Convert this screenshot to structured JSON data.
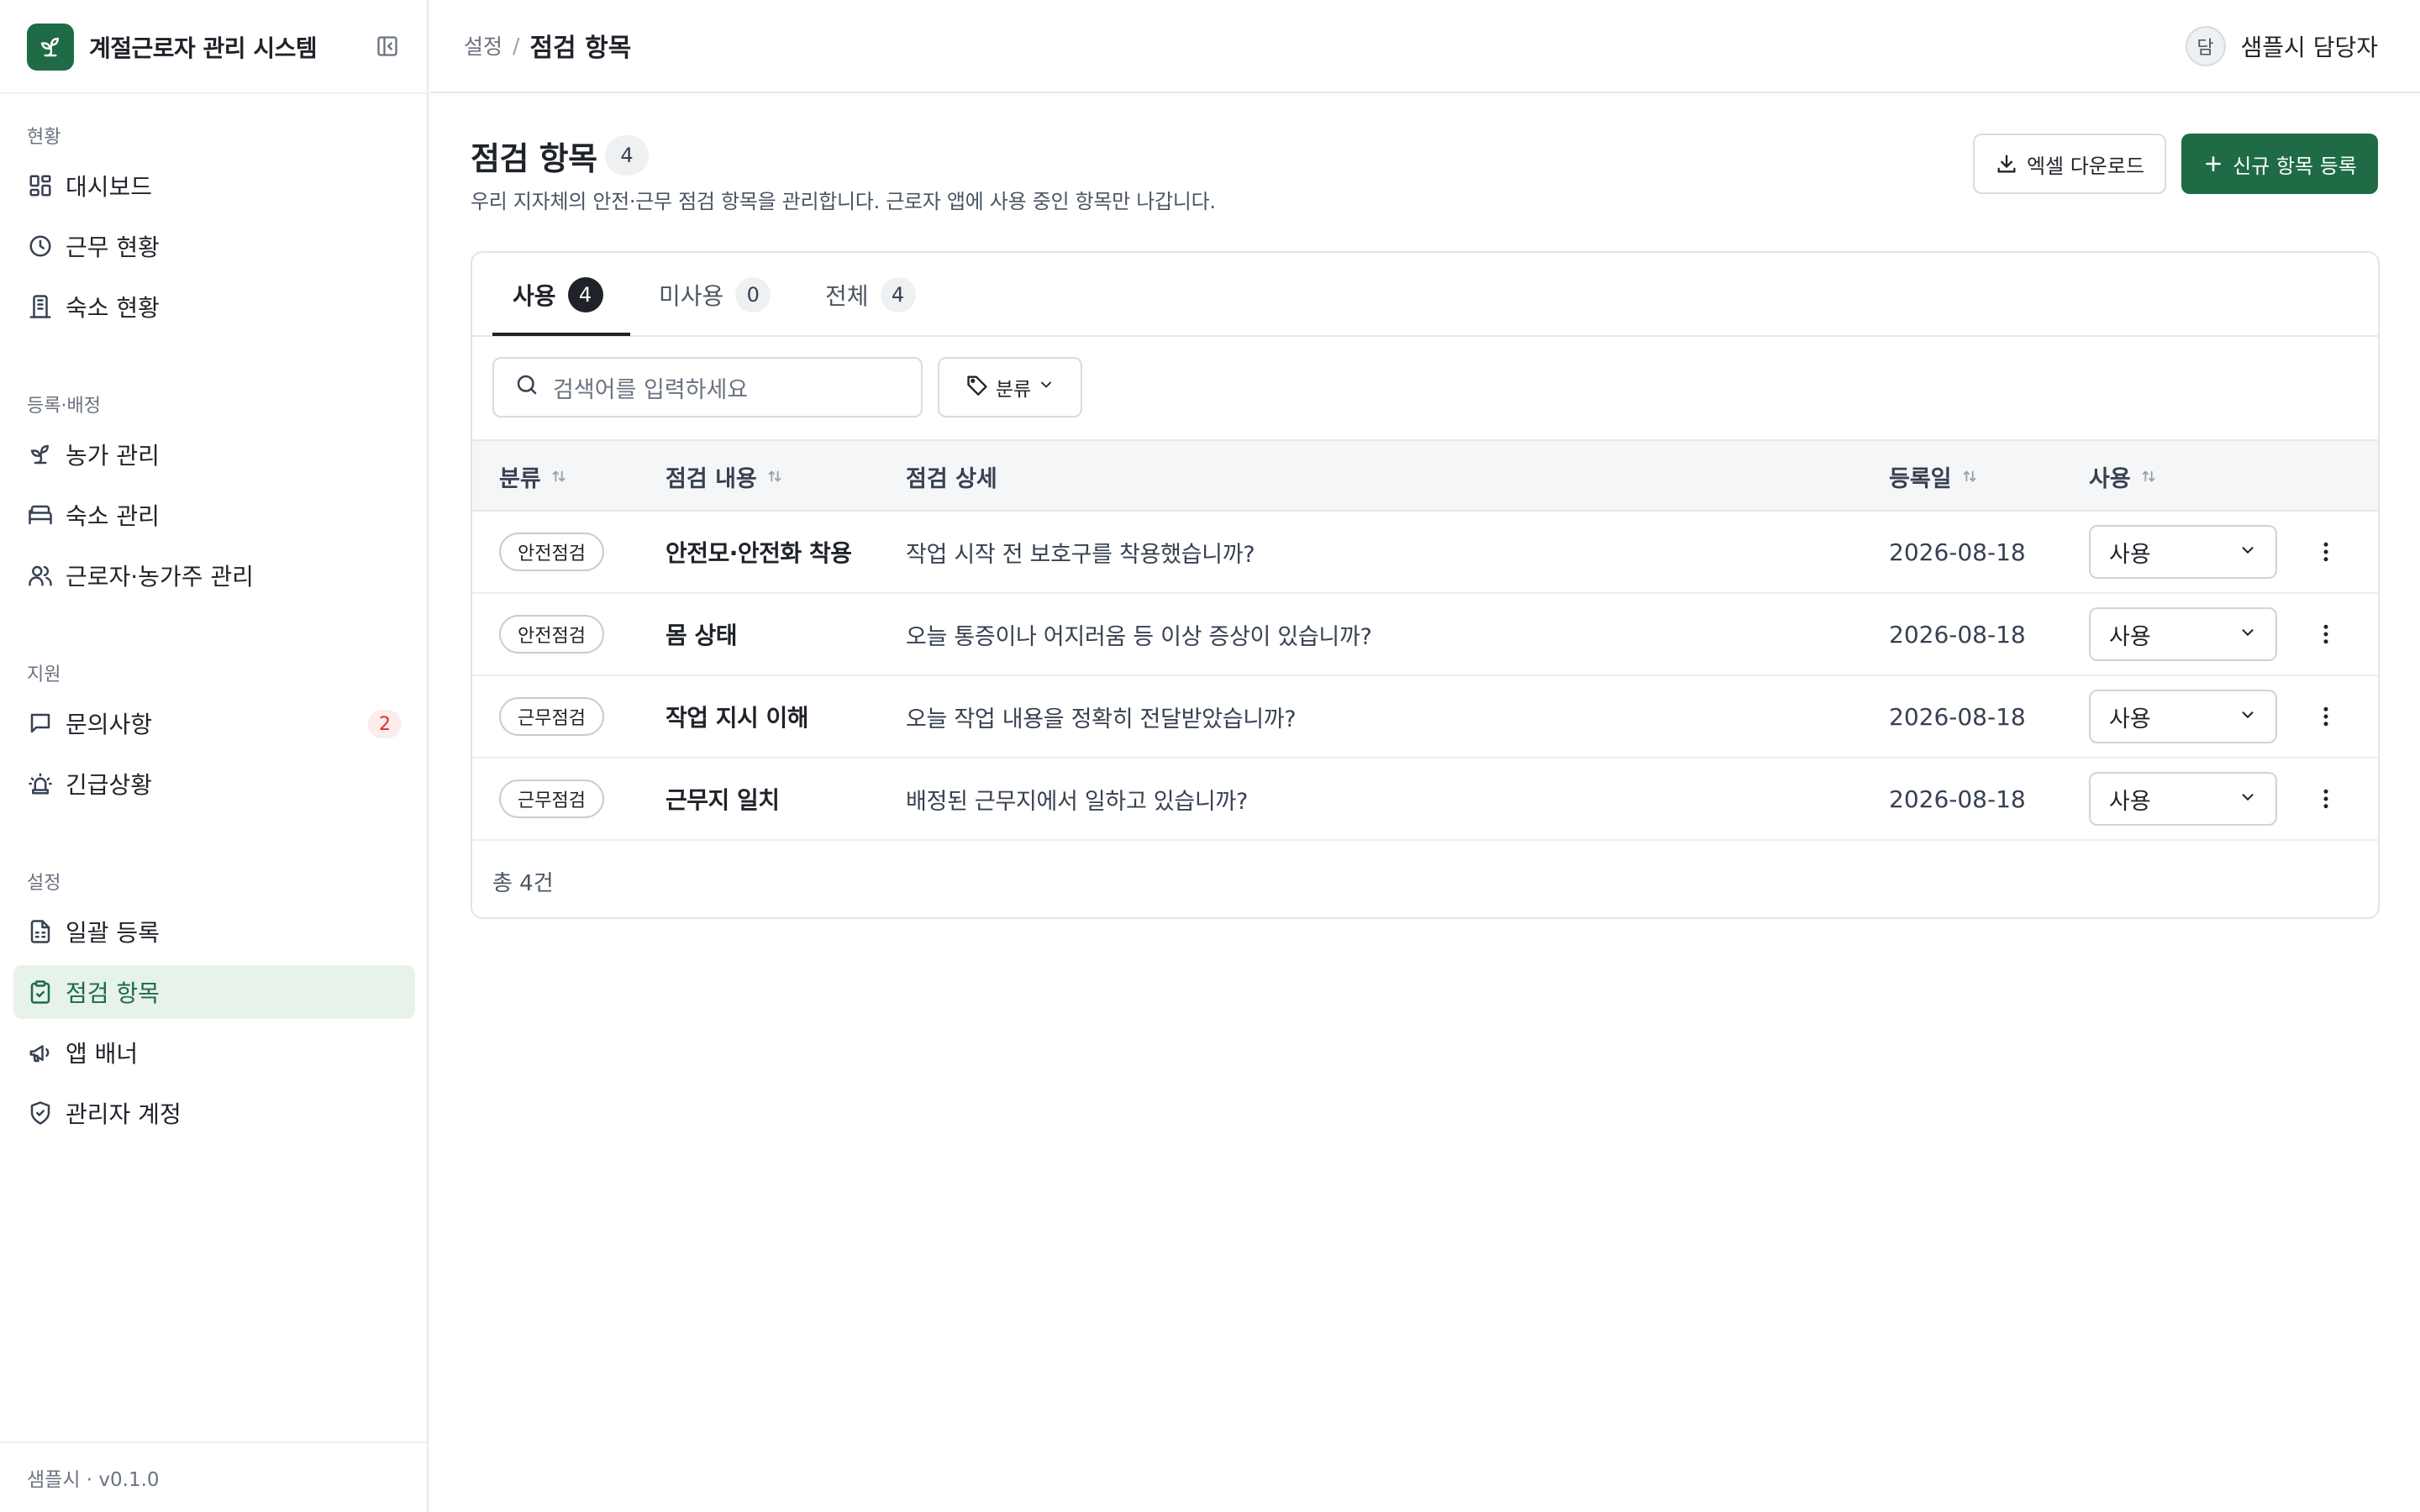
{
  "app": {
    "name": "계절근로자 관리 시스템",
    "version_label": "샘플시 · v0.1.0"
  },
  "sidebar": {
    "groups": [
      {
        "title": "현황",
        "items": [
          {
            "label": "대시보드",
            "icon": "dashboard-icon"
          },
          {
            "label": "근무 현황",
            "icon": "clock-icon"
          },
          {
            "label": "숙소 현황",
            "icon": "building-icon"
          }
        ]
      },
      {
        "title": "등록·배정",
        "items": [
          {
            "label": "농가 관리",
            "icon": "sprout-icon"
          },
          {
            "label": "숙소 관리",
            "icon": "bed-icon"
          },
          {
            "label": "근로자·농가주 관리",
            "icon": "users-icon"
          }
        ]
      },
      {
        "title": "지원",
        "items": [
          {
            "label": "문의사항",
            "icon": "message-icon",
            "badge": "2"
          },
          {
            "label": "긴급상황",
            "icon": "siren-icon"
          }
        ]
      },
      {
        "title": "설정",
        "items": [
          {
            "label": "일괄 등록",
            "icon": "spreadsheet-icon"
          },
          {
            "label": "점검 항목",
            "icon": "clipboard-check-icon",
            "active": true
          },
          {
            "label": "앱 배너",
            "icon": "megaphone-icon"
          },
          {
            "label": "관리자 계정",
            "icon": "shield-check-icon"
          }
        ]
      }
    ]
  },
  "header": {
    "breadcrumb_parent": "설정",
    "breadcrumb_sep": "/",
    "breadcrumb_current": "점검 항목",
    "user_initial": "담",
    "user_name": "샘플시 담당자"
  },
  "page": {
    "title": "점검 항목",
    "count": "4",
    "description": "우리 지자체의 안전·근무 점검 항목을 관리합니다. 근로자 앱에 사용 중인 항목만 나갑니다.",
    "excel_button": "엑셀 다운로드",
    "new_button": "신규 항목 등록"
  },
  "tabs": [
    {
      "label": "사용",
      "count": "4",
      "active": true
    },
    {
      "label": "미사용",
      "count": "0"
    },
    {
      "label": "전체",
      "count": "4"
    }
  ],
  "search": {
    "placeholder": "검색어를 입력하세요"
  },
  "filter": {
    "label": "분류"
  },
  "table": {
    "columns": [
      "분류",
      "점검 내용",
      "점검 상세",
      "등록일",
      "사용"
    ],
    "rows": [
      {
        "category": "안전점검",
        "title": "안전모·안전화 착용",
        "detail": "작업 시작 전 보호구를 착용했습니까?",
        "date": "2026-08-18",
        "status": "사용"
      },
      {
        "category": "안전점검",
        "title": "몸 상태",
        "detail": "오늘 통증이나 어지러움 등 이상 증상이 있습니까?",
        "date": "2026-08-18",
        "status": "사용"
      },
      {
        "category": "근무점검",
        "title": "작업 지시 이해",
        "detail": "오늘 작업 내용을 정확히 전달받았습니까?",
        "date": "2026-08-18",
        "status": "사용"
      },
      {
        "category": "근무점검",
        "title": "근무지 일치",
        "detail": "배정된 근무지에서 일하고 있습니까?",
        "date": "2026-08-18",
        "status": "사용"
      }
    ],
    "total_label": "총 4건"
  },
  "colors": {
    "brand": "#1e6b45",
    "active_bg": "#e6f2ea",
    "badge_red": "#d93025"
  }
}
